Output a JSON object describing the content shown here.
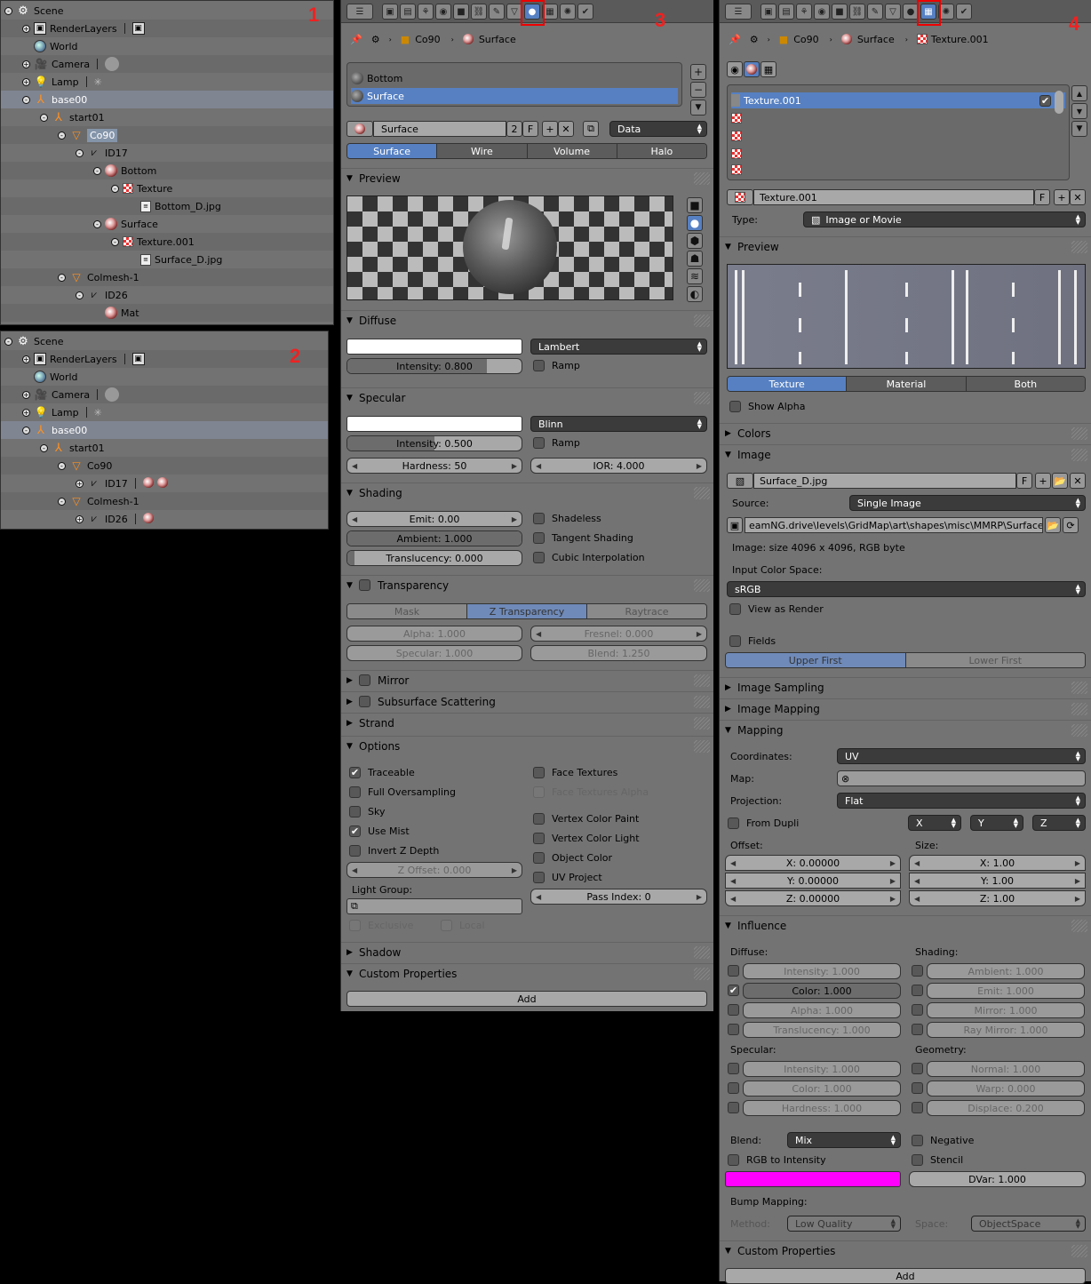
{
  "outliner1": {
    "number": "1",
    "rows": [
      {
        "label": "Scene",
        "icon": "scene-icon",
        "depth": 0,
        "expand": "-"
      },
      {
        "label": "RenderLayers",
        "icon": "renderlayers-icon",
        "depth": 1,
        "expand": "+",
        "extra": "rl"
      },
      {
        "label": "World",
        "icon": "world-icon",
        "depth": 1,
        "expand": ""
      },
      {
        "label": "Camera",
        "icon": "camera-icon",
        "depth": 1,
        "expand": "+",
        "extra": "cam"
      },
      {
        "label": "Lamp",
        "icon": "lamp-icon",
        "depth": 1,
        "expand": "+",
        "extra": "lamp"
      },
      {
        "label": "base00",
        "icon": "empty-icon",
        "depth": 1,
        "expand": "-",
        "sel": "obj"
      },
      {
        "label": "start01",
        "icon": "empty-icon",
        "depth": 2,
        "expand": "-"
      },
      {
        "label": "Co90",
        "icon": "mesh-object-icon",
        "depth": 3,
        "expand": "-",
        "sel": "hl"
      },
      {
        "label": "ID17",
        "icon": "mesh-data-icon",
        "depth": 4,
        "expand": "-"
      },
      {
        "label": "Bottom",
        "icon": "material-icon",
        "depth": 5,
        "expand": "-"
      },
      {
        "label": "Texture",
        "icon": "texture-icon",
        "depth": 6,
        "expand": "-"
      },
      {
        "label": "Bottom_D.jpg",
        "icon": "image-icon",
        "depth": 7,
        "expand": ""
      },
      {
        "label": "Surface",
        "icon": "material-icon",
        "depth": 5,
        "expand": "-"
      },
      {
        "label": "Texture.001",
        "icon": "texture-icon",
        "depth": 6,
        "expand": "-"
      },
      {
        "label": "Surface_D.jpg",
        "icon": "image-icon",
        "depth": 7,
        "expand": ""
      },
      {
        "label": "Colmesh-1",
        "icon": "mesh-object-icon",
        "depth": 3,
        "expand": "-"
      },
      {
        "label": "ID26",
        "icon": "mesh-data-icon",
        "depth": 4,
        "expand": "-"
      },
      {
        "label": "Mat",
        "icon": "material-icon",
        "depth": 5,
        "expand": ""
      }
    ]
  },
  "outliner2": {
    "number": "2",
    "rows": [
      {
        "label": "Scene",
        "icon": "scene-icon",
        "depth": 0,
        "expand": "-"
      },
      {
        "label": "RenderLayers",
        "icon": "renderlayers-icon",
        "depth": 1,
        "expand": "+",
        "extra": "rl"
      },
      {
        "label": "World",
        "icon": "world-icon",
        "depth": 1,
        "expand": ""
      },
      {
        "label": "Camera",
        "icon": "camera-icon",
        "depth": 1,
        "expand": "+",
        "extra": "cam"
      },
      {
        "label": "Lamp",
        "icon": "lamp-icon",
        "depth": 1,
        "expand": "+",
        "extra": "lamp"
      },
      {
        "label": "base00",
        "icon": "empty-icon",
        "depth": 1,
        "expand": "-",
        "sel": "obj"
      },
      {
        "label": "start01",
        "icon": "empty-icon",
        "depth": 2,
        "expand": "-"
      },
      {
        "label": "Co90",
        "icon": "mesh-object-icon",
        "depth": 3,
        "expand": "-"
      },
      {
        "label": "ID17",
        "icon": "mesh-data-icon",
        "depth": 4,
        "expand": "+",
        "extra": "mat2"
      },
      {
        "label": "Colmesh-1",
        "icon": "mesh-object-icon",
        "depth": 3,
        "expand": "-"
      },
      {
        "label": "ID26",
        "icon": "mesh-data-icon",
        "depth": 4,
        "expand": "+",
        "extra": "mat1"
      }
    ]
  },
  "material": {
    "number": "3",
    "crumb_object": "Co90",
    "crumb_material": "Surface",
    "slots": [
      "Bottom",
      "Surface"
    ],
    "name": "Surface",
    "users": "2",
    "fake": "F",
    "link": "Data",
    "tabs": [
      "Surface",
      "Wire",
      "Volume",
      "Halo"
    ],
    "preview": "Preview",
    "diffuse": {
      "title": "Diffuse",
      "shader": "Lambert",
      "intensity": "Intensity: 0.800",
      "intensity_fraction": 0.8,
      "ramp": "Ramp"
    },
    "specular": {
      "title": "Specular",
      "shader": "Blinn",
      "intensity": "Intensity: 0.500",
      "intensity_fraction": 0.5,
      "ramp": "Ramp",
      "hardness": "Hardness: 50",
      "ior": "IOR: 4.000"
    },
    "shading": {
      "title": "Shading",
      "emit": "Emit: 0.00",
      "ambient": "Ambient: 1.000",
      "ambient_fraction": 1.0,
      "translucency": "Translucency: 0.000",
      "shadeless": "Shadeless",
      "tangent": "Tangent Shading",
      "cubic": "Cubic Interpolation"
    },
    "transparency": {
      "title": "Transparency",
      "tabs": [
        "Mask",
        "Z Transparency",
        "Raytrace"
      ],
      "alpha": "Alpha: 1.000",
      "fresnel": "Fresnel: 0.000",
      "specular": "Specular: 1.000",
      "blend": "Blend: 1.250"
    },
    "mirror": "Mirror",
    "sss": "Subsurface Scattering",
    "strand": "Strand",
    "options": {
      "title": "Options",
      "traceable": "Traceable",
      "full_os": "Full Oversampling",
      "sky": "Sky",
      "use_mist": "Use Mist",
      "invert_z": "Invert Z Depth",
      "z_offset": "Z Offset: 0.000",
      "light_group": "Light Group:",
      "exclusive": "Exclusive",
      "local": "Local",
      "face_tex": "Face Textures",
      "face_tex_alpha": "Face Textures Alpha",
      "vc_paint": "Vertex Color Paint",
      "vc_light": "Vertex Color Light",
      "obj_color": "Object Color",
      "uv_project": "UV Project",
      "pass_index": "Pass Index: 0"
    },
    "shadow": "Shadow",
    "custom_props": "Custom Properties",
    "add": "Add"
  },
  "texture": {
    "number": "4",
    "crumb_object": "Co90",
    "crumb_material": "Surface",
    "crumb_texture": "Texture.001",
    "slot_name": "Texture.001",
    "name": "Texture.001",
    "fake": "F",
    "type_label": "Type:",
    "type": "Image or Movie",
    "preview": "Preview",
    "preview_tabs": [
      "Texture",
      "Material",
      "Both"
    ],
    "show_alpha": "Show Alpha",
    "colors": "Colors",
    "image": {
      "title": "Image",
      "name": "Surface_D.jpg",
      "fake": "F",
      "source_label": "Source:",
      "source": "Single Image",
      "path": "eamNG.drive\\levels\\GridMap\\art\\shapes\\misc\\MMRP\\Surface_D.jpg",
      "info": "Image: size 4096 x 4096, RGB byte",
      "ics_label": "Input Color Space:",
      "ics": "sRGB",
      "view_as_render": "View as Render",
      "fields": "Fields",
      "field_tabs": [
        "Upper First",
        "Lower First"
      ]
    },
    "image_sampling": "Image Sampling",
    "image_mapping": "Image Mapping",
    "mapping": {
      "title": "Mapping",
      "coords_label": "Coordinates:",
      "coords": "UV",
      "map_label": "Map:",
      "proj_label": "Projection:",
      "proj": "Flat",
      "from_dupli": "From Dupli",
      "x": "X",
      "y": "Y",
      "z": "Z",
      "offset_label": "Offset:",
      "size_label": "Size:",
      "off_x": "X: 0.00000",
      "off_y": "Y: 0.00000",
      "off_z": "Z: 0.00000",
      "size_x": "X: 1.00",
      "size_y": "Y: 1.00",
      "size_z": "Z: 1.00"
    },
    "influence": {
      "title": "Influence",
      "diffuse_label": "Diffuse:",
      "shading_label": "Shading:",
      "d_int": "Intensity: 1.000",
      "d_col": "Color: 1.000",
      "d_alpha": "Alpha: 1.000",
      "d_trans": "Translucency: 1.000",
      "s_amb": "Ambient: 1.000",
      "s_emit": "Emit: 1.000",
      "s_mirror": "Mirror: 1.000",
      "s_raymir": "Ray Mirror: 1.000",
      "spec_label": "Specular:",
      "geom_label": "Geometry:",
      "sp_int": "Intensity: 1.000",
      "sp_col": "Color: 1.000",
      "sp_hard": "Hardness: 1.000",
      "g_normal": "Normal: 1.000",
      "g_warp": "Warp: 0.000",
      "g_disp": "Displace: 0.200",
      "blend_label": "Blend:",
      "blend": "Mix",
      "negative": "Negative",
      "rgb_to_int": "RGB to Intensity",
      "stencil": "Stencil",
      "dvar": "DVar: 1.000",
      "bump_label": "Bump Mapping:",
      "method_label": "Method:",
      "method": "Low Quality",
      "space_label": "Space:",
      "space": "ObjectSpace",
      "color": "#ff00ff"
    },
    "custom_props": "Custom Properties",
    "add": "Add"
  }
}
